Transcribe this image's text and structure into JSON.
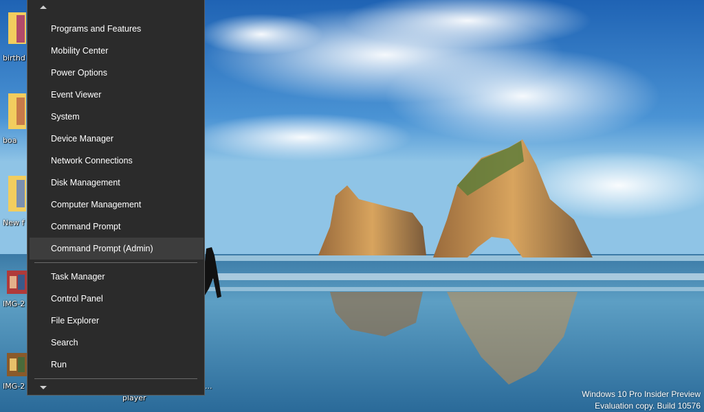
{
  "desktop": {
    "icons": [
      {
        "label": "birthd",
        "kind": "folder"
      },
      {
        "label": "boa",
        "kind": "folder"
      },
      {
        "label": "New f",
        "kind": "folder"
      },
      {
        "label": "IMG-2",
        "kind": "image"
      },
      {
        "label": "IMG-2",
        "kind": "image"
      }
    ],
    "player_label": "player",
    "dots_label": "..."
  },
  "menu": {
    "group1": [
      {
        "label": "Programs and Features"
      },
      {
        "label": "Mobility Center"
      },
      {
        "label": "Power Options"
      },
      {
        "label": "Event Viewer"
      },
      {
        "label": "System"
      },
      {
        "label": "Device Manager"
      },
      {
        "label": "Network Connections"
      },
      {
        "label": "Disk Management"
      },
      {
        "label": "Computer Management"
      },
      {
        "label": "Command Prompt"
      },
      {
        "label": "Command Prompt (Admin)"
      }
    ],
    "group2": [
      {
        "label": "Task Manager"
      },
      {
        "label": "Control Panel"
      },
      {
        "label": "File Explorer"
      },
      {
        "label": "Search"
      },
      {
        "label": "Run"
      }
    ],
    "highlighted_item": "Command Prompt (Admin)",
    "scroll_up_icon": "triangle-up-icon",
    "scroll_down_icon": "triangle-down-icon"
  },
  "watermark": {
    "line1": "Windows 10 Pro Insider Preview",
    "line2": "Evaluation copy. Build 10576"
  },
  "colors": {
    "menu_bg": "#2b2b2b",
    "menu_highlight": "#3d3d3d",
    "menu_text": "#ffffff"
  }
}
